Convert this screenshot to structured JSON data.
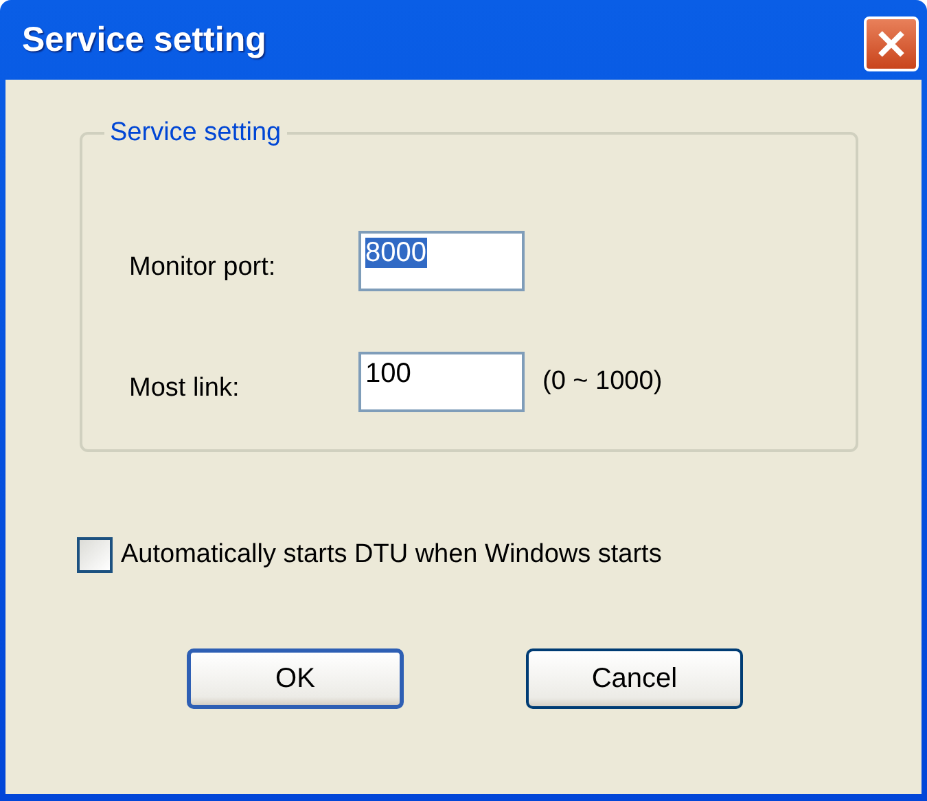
{
  "window": {
    "title": "Service setting"
  },
  "group": {
    "legend": "Service setting",
    "fields": [
      {
        "label": "Monitor port:",
        "value": "8000",
        "text_selected": true
      },
      {
        "label": "Most link:",
        "value": "100",
        "text_selected": false,
        "hint": "(0 ~ 1000)"
      }
    ]
  },
  "checkbox": {
    "label": "Automatically starts DTU when Windows starts",
    "checked": false
  },
  "buttons": [
    {
      "label": "OK",
      "default": true
    },
    {
      "label": "Cancel",
      "default": false
    }
  ]
}
